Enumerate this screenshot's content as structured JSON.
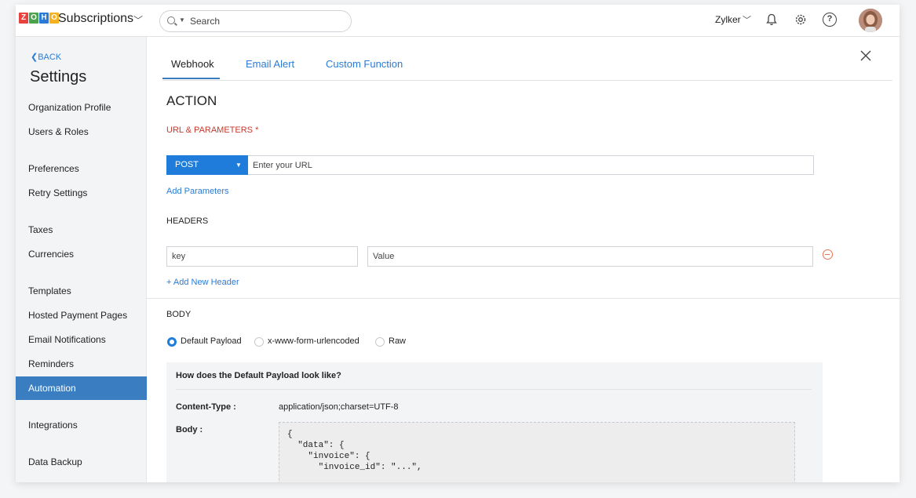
{
  "topbar": {
    "logo_letters": [
      "Z",
      "O",
      "H",
      "O"
    ],
    "logo_colors": [
      "#e8423f",
      "#4da34d",
      "#2a7bd5",
      "#f5b11e"
    ],
    "product": "Subscriptions",
    "search_placeholder": "Search",
    "org": "Zylker"
  },
  "sidebar": {
    "back": "BACK",
    "title": "Settings",
    "items": [
      "Organization Profile",
      "Users & Roles",
      "Preferences",
      "Retry Settings",
      "Taxes",
      "Currencies",
      "Templates",
      "Hosted Payment Pages",
      "Email Notifications",
      "Reminders",
      "Automation",
      "Integrations",
      "Data Backup"
    ],
    "active": "Automation"
  },
  "tabs": [
    "Webhook",
    "Email Alert",
    "Custom Function"
  ],
  "action": {
    "title": "ACTION",
    "url_label": "URL & PARAMETERS *",
    "method": "POST",
    "url_placeholder": "Enter your URL",
    "add_parameters": "Add Parameters",
    "headers_label": "HEADERS",
    "header_key_placeholder": "key",
    "header_value_placeholder": "Value",
    "add_header": "+ Add New Header",
    "body_label": "BODY",
    "body_options": [
      "Default Payload",
      "x-www-form-urlencoded",
      "Raw"
    ],
    "body_selected": "Default Payload"
  },
  "payload": {
    "title": "How does the Default Payload look like?",
    "content_type_label": "Content-Type :",
    "content_type_value": "application/json;charset=UTF-8",
    "body_label": "Body :",
    "code": [
      "{",
      "  \"data\": {",
      "    \"invoice\": {",
      "      \"invoice_id\": \"...\","
    ]
  },
  "colors": {
    "accent": "#1f7cdb",
    "active_nav": "#3a7ec1",
    "required": "#c6392c",
    "remove": "#e8714f"
  }
}
